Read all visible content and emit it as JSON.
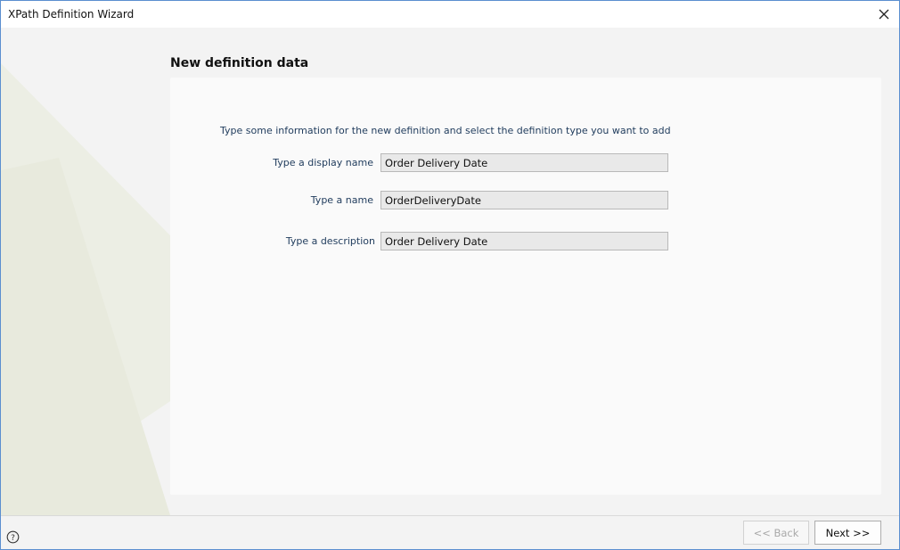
{
  "window": {
    "title": "XPath Definition Wizard",
    "close_icon": "close-icon"
  },
  "page": {
    "title": "New definition data",
    "instructions": "Type some information for the new definition and select the definition type you want to add"
  },
  "form": {
    "display_name": {
      "label": "Type a display name",
      "value": "Order Delivery Date"
    },
    "name": {
      "label": "Type a name",
      "value": "OrderDeliveryDate"
    },
    "description": {
      "label": "Type a description",
      "value": "Order Delivery Date"
    }
  },
  "footer": {
    "help_icon": "help-icon",
    "back_label": "<< Back",
    "next_label": "Next >>"
  },
  "colors": {
    "accent_border": "#5b8fd0",
    "label_text": "#1f3b5c",
    "input_bg": "#e9e9e9"
  }
}
